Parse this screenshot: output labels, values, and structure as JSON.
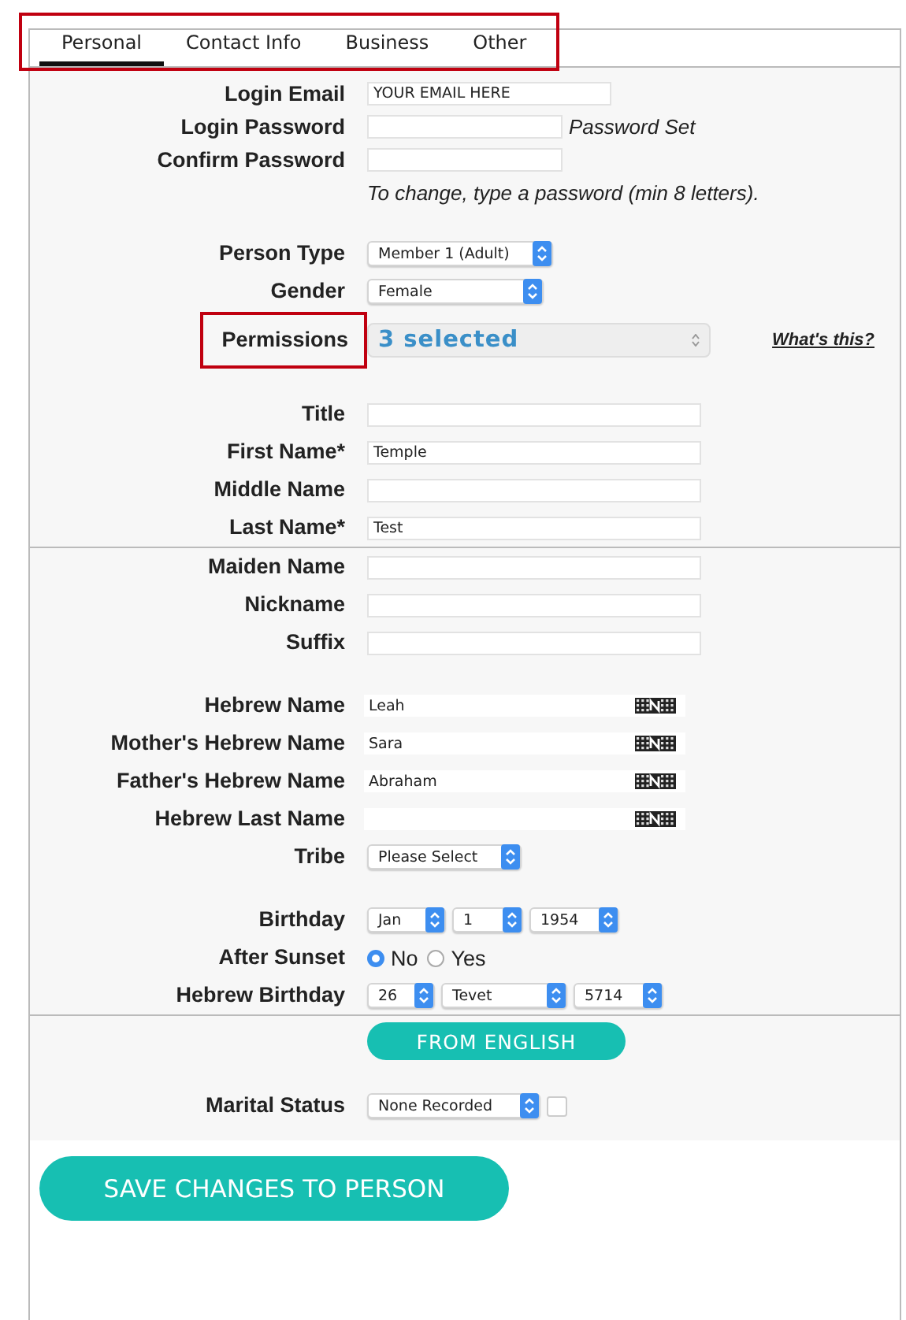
{
  "tabs_bar": {
    "highlighted": true,
    "tabs": [
      {
        "label": "Personal",
        "selected": true
      },
      {
        "label": "Contact Info",
        "selected": false
      },
      {
        "label": "Business",
        "selected": false
      },
      {
        "label": "Other",
        "selected": false
      }
    ]
  },
  "groups": [
    {
      "rows": [
        {
          "kind": "email",
          "label": "Login Email",
          "value": "YOUR EMAIL HERE"
        },
        {
          "kind": "password",
          "label": "Login Password",
          "suffix": "Password Set"
        },
        {
          "kind": "password",
          "label": "Confirm Password"
        },
        {
          "kind": "note",
          "text": "To change, type a password (min 8 letters)."
        }
      ]
    },
    {
      "rows": [
        {
          "kind": "select",
          "label": "Person Type",
          "selects": [
            {
              "value": "Member 1 (Adult)"
            }
          ]
        },
        {
          "kind": "select",
          "label": "Gender",
          "selects": [
            {
              "value": "Female"
            }
          ]
        },
        {
          "kind": "multiselect",
          "label": "Permissions",
          "highlighted": true,
          "value": "3 selected",
          "link": "What's this?"
        }
      ]
    },
    {
      "rows": [
        {
          "kind": "text",
          "label": "Title"
        },
        {
          "kind": "text",
          "label": "First Name*",
          "value": "Temple"
        },
        {
          "kind": "text",
          "label": "Middle Name"
        },
        {
          "kind": "text",
          "label": "Last Name*",
          "value": "Test"
        },
        {
          "kind": "text",
          "label": "Maiden Name",
          "rule_above": true
        },
        {
          "kind": "text",
          "label": "Nickname"
        },
        {
          "kind": "text",
          "label": "Suffix"
        }
      ]
    },
    {
      "rows": [
        {
          "kind": "hebrew",
          "label": "Hebrew Name",
          "value": "Leah"
        },
        {
          "kind": "hebrew",
          "label": "Mother's Hebrew Name",
          "value": "Sara"
        },
        {
          "kind": "hebrew",
          "label": "Father's Hebrew Name",
          "value": "Abraham"
        },
        {
          "kind": "hebrew",
          "label": "Hebrew Last Name"
        },
        {
          "kind": "select",
          "label": "Tribe",
          "selects": [
            {
              "value": "Please Select"
            }
          ]
        }
      ]
    },
    {
      "rows": [
        {
          "kind": "select",
          "label": "Birthday",
          "selects": [
            {
              "value": "Jan"
            },
            {
              "value": "1"
            },
            {
              "value": "1954"
            }
          ]
        },
        {
          "kind": "radio",
          "label": "After Sunset",
          "options": [
            {
              "label": "No",
              "selected": true
            },
            {
              "label": "Yes",
              "selected": false
            }
          ]
        },
        {
          "kind": "select",
          "label": "Hebrew Birthday",
          "selects": [
            {
              "value": "26"
            },
            {
              "value": "Tevet"
            },
            {
              "value": "5714"
            }
          ]
        },
        {
          "kind": "button",
          "label_text": "FROM ENGLISH",
          "rule_above": true
        }
      ]
    },
    {
      "rows": [
        {
          "kind": "select",
          "label": "Marital Status",
          "selects": [
            {
              "value": "None Recorded"
            }
          ],
          "checkbox": {
            "checked": false
          }
        }
      ]
    }
  ],
  "save_button": "SAVE CHANGES TO PERSON"
}
